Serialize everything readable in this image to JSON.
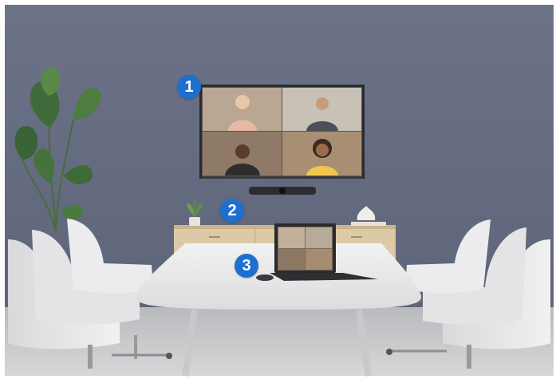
{
  "markers": [
    {
      "label": "1",
      "target": "wall-display"
    },
    {
      "label": "2",
      "target": "video-bar"
    },
    {
      "label": "3",
      "target": "table-puck"
    }
  ],
  "colors": {
    "wall": "#6a7188",
    "floor": "#c4c4c7",
    "badge": "#1f6fd1",
    "table": "#e9e9ea",
    "cabinet": "#dcc9a5"
  }
}
